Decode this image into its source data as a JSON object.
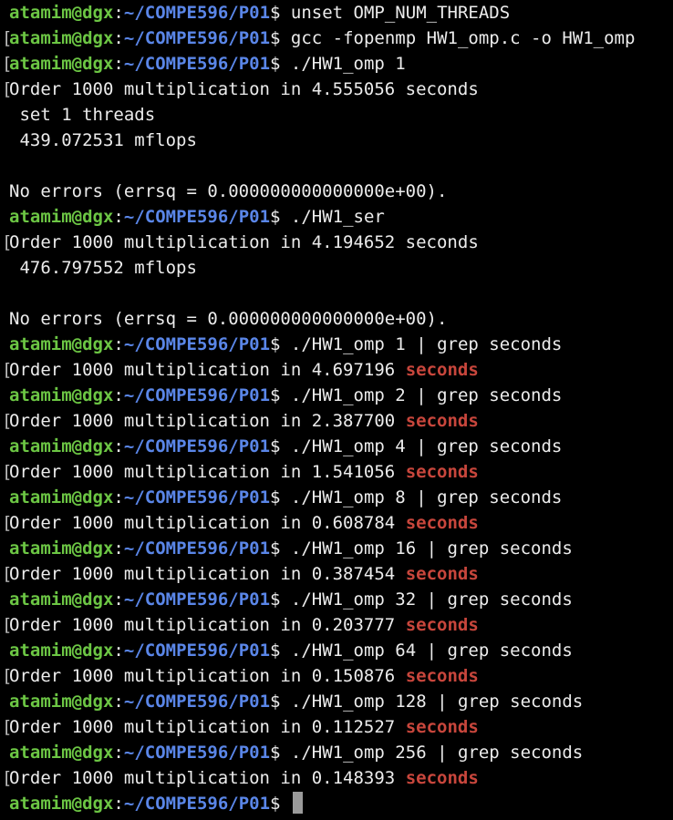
{
  "prompt": {
    "user": "atamim",
    "at": "@",
    "host": "dgx",
    "colon": ":",
    "path": "~/COMPE596/P01",
    "dollar": "$ "
  },
  "lines": {
    "l0": {
      "cmd": "unset OMP_NUM_THREADS"
    },
    "l1": {
      "cmd": "gcc -fopenmp HW1_omp.c -o HW1_omp"
    },
    "l2": {
      "cmd": "./HW1_omp 1"
    },
    "l3": {
      "text": "Order 1000 multiplication in 4.555056 seconds"
    },
    "l4": {
      "text": " set 1 threads"
    },
    "l5": {
      "text": " 439.072531 mflops"
    },
    "l6": {
      "text": ""
    },
    "l7": {
      "text": "No errors (errsq = 0.000000000000000e+00)."
    },
    "l8": {
      "cmd": "./HW1_ser"
    },
    "l9": {
      "text": "Order 1000 multiplication in 4.194652 seconds"
    },
    "l10": {
      "text": " 476.797552 mflops"
    },
    "l11": {
      "text": ""
    },
    "l12": {
      "text": "No errors (errsq = 0.000000000000000e+00)."
    },
    "l13": {
      "cmd": "./HW1_omp 1 | grep seconds"
    },
    "l14": {
      "pre": "Order 1000 multiplication in 4.697196 ",
      "match": "seconds"
    },
    "l15": {
      "cmd": "./HW1_omp 2 | grep seconds"
    },
    "l16": {
      "pre": "Order 1000 multiplication in 2.387700 ",
      "match": "seconds"
    },
    "l17": {
      "cmd": "./HW1_omp 4 | grep seconds"
    },
    "l18": {
      "pre": "Order 1000 multiplication in 1.541056 ",
      "match": "seconds"
    },
    "l19": {
      "cmd": "./HW1_omp 8 | grep seconds"
    },
    "l20": {
      "pre": "Order 1000 multiplication in 0.608784 ",
      "match": "seconds"
    },
    "l21": {
      "cmd": "./HW1_omp 16 | grep seconds"
    },
    "l22": {
      "pre": "Order 1000 multiplication in 0.387454 ",
      "match": "seconds"
    },
    "l23": {
      "cmd": "./HW1_omp 32 | grep seconds"
    },
    "l24": {
      "pre": "Order 1000 multiplication in 0.203777 ",
      "match": "seconds"
    },
    "l25": {
      "cmd": "./HW1_omp 64 | grep seconds"
    },
    "l26": {
      "pre": "Order 1000 multiplication in 0.150876 ",
      "match": "seconds"
    },
    "l27": {
      "cmd": "./HW1_omp 128 | grep seconds"
    },
    "l28": {
      "pre": "Order 1000 multiplication in 0.112527 ",
      "match": "seconds"
    },
    "l29": {
      "cmd": "./HW1_omp 256 | grep seconds"
    },
    "l30": {
      "pre": "Order 1000 multiplication in 0.148393 ",
      "match": "seconds"
    },
    "l31": {
      "cmd": ""
    }
  },
  "bracket_char": "[",
  "colors": {
    "background": "#000000",
    "foreground": "#ececec",
    "prompt_user_host": "#6cc644",
    "prompt_path": "#5a86e8",
    "grep_match": "#c8463c",
    "cursor": "#9a9a9a"
  }
}
